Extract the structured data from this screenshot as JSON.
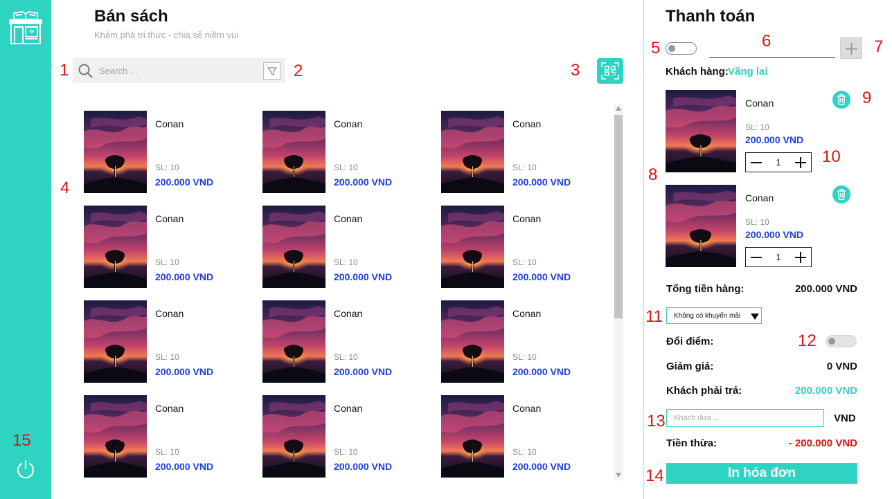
{
  "main": {
    "title": "Bán sách",
    "subtitle": "Khám phá tri thức - chia sẻ niềm vui"
  },
  "search": {
    "placeholder": "Search ..."
  },
  "products": [
    {
      "name": "Conan",
      "qty": "SL: 10",
      "price": "200.000 VND"
    },
    {
      "name": "Conan",
      "qty": "SL: 10",
      "price": "200.000 VND"
    },
    {
      "name": "Conan",
      "qty": "SL: 10",
      "price": "200.000 VND"
    },
    {
      "name": "Conan",
      "qty": "SL: 10",
      "price": "200.000 VND"
    },
    {
      "name": "Conan",
      "qty": "SL: 10",
      "price": "200.000 VND"
    },
    {
      "name": "Conan",
      "qty": "SL: 10",
      "price": "200.000 VND"
    },
    {
      "name": "Conan",
      "qty": "SL: 10",
      "price": "200.000 VND"
    },
    {
      "name": "Conan",
      "qty": "SL: 10",
      "price": "200.000 VND"
    },
    {
      "name": "Conan",
      "qty": "SL: 10",
      "price": "200.000 VND"
    },
    {
      "name": "Conan",
      "qty": "SL: 10",
      "price": "200.000 VND"
    },
    {
      "name": "Conan",
      "qty": "SL: 10",
      "price": "200.000 VND"
    },
    {
      "name": "Conan",
      "qty": "SL: 10",
      "price": "200.000 VND"
    }
  ],
  "payment": {
    "title": "Thanh toán",
    "customer_label": "Khách hàng:",
    "customer_value": "Vãng lai",
    "cart": [
      {
        "name": "Conan",
        "qty": "SL: 10",
        "price": "200.000 VND",
        "count": "1"
      },
      {
        "name": "Conan",
        "qty": "SL: 10",
        "price": "200.000 VND",
        "count": "1"
      }
    ],
    "subtotal_label": "Tổng tiền hàng:",
    "subtotal_value": "200.000 VND",
    "promo_selected": "Không có khuyến mãi",
    "points_label": "Đổi điểm:",
    "discount_label": "Giảm giá:",
    "discount_value": "0 VND",
    "due_label": "Khách phải trả:",
    "due_value": "200.000 VND",
    "cash_placeholder": "Khách đưa ...",
    "cash_unit": "VND",
    "change_label": "Tiền thừa:",
    "change_value": "- 200.000 VND",
    "print_label": "In hóa đơn"
  },
  "annotations": [
    "1",
    "2",
    "3",
    "4",
    "5",
    "6",
    "7",
    "8",
    "9",
    "10",
    "11",
    "12",
    "13",
    "14",
    "15"
  ],
  "colors": {
    "accent": "#2ed3c1",
    "price": "#1f3de0",
    "negative": "#e31212",
    "annotation": "#e31212"
  },
  "icons": {
    "sidebar_logo": "bookstore-icon",
    "logout": "power-icon",
    "search": "search-icon",
    "filter": "filter-icon",
    "scan": "qr-scan-icon",
    "add_customer": "plus-icon",
    "delete": "trash-icon",
    "decrease": "minus-icon",
    "increase": "plus-icon",
    "dropdown": "caret-down-icon"
  }
}
